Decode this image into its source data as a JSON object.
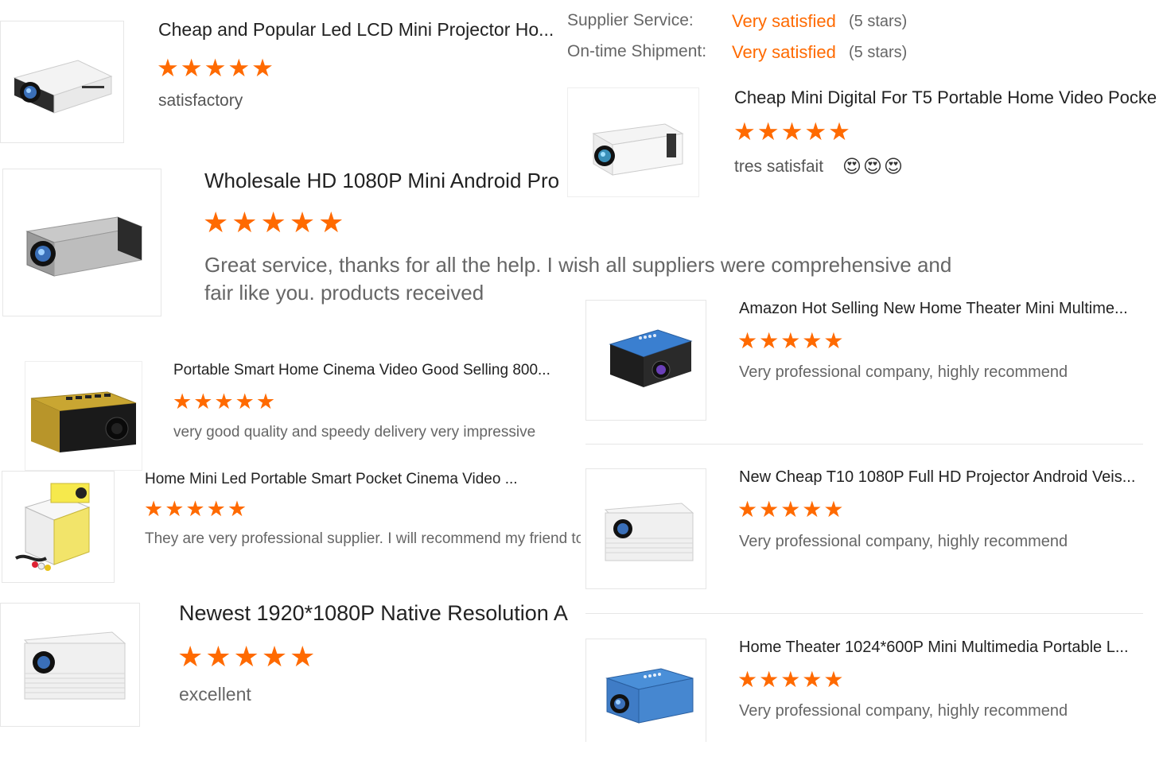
{
  "rating_summary": {
    "supplier_service_label": "Supplier Service:",
    "supplier_service_value": "Very satisfied",
    "supplier_service_stars": "(5 stars)",
    "shipment_label": "On-time Shipment:",
    "shipment_value": "Very satisfied",
    "shipment_stars": "(5 stars)"
  },
  "star_glyphs": "★★★★★",
  "reviews": [
    {
      "title": "Cheap and Popular Led LCD Mini Projector Ho...",
      "comment": "satisfactory",
      "rating": 5,
      "image": "white-projector-icon"
    },
    {
      "title": "Cheap Mini Digital For T5 Portable Home Video Pocke",
      "comment": "tres satisfait",
      "emoji": "😍😍😍",
      "rating": 5,
      "image": "white-projector-icon"
    },
    {
      "title": "Wholesale HD 1080P Mini Android Pro",
      "comment_line1": "Great service, thanks for all the help. I wish all suppliers were comprehensive and",
      "comment_line2": "fair like you. products received",
      "rating": 5,
      "image": "silver-projector-icon"
    },
    {
      "title": "Amazon Hot Selling New Home Theater Mini Multime...",
      "comment": "Very professional company, highly recommend",
      "rating": 5,
      "image": "blue-projector-icon"
    },
    {
      "title": "Portable Smart Home Cinema Video Good Selling 800...",
      "comment": "very good quality and speedy delivery very impressive",
      "rating": 5,
      "image": "yellow-projector-icon"
    },
    {
      "title": "Home Mini Led Portable Smart Pocket Cinema Video ...",
      "comment": "They are very professional supplier. I will recommend my friend to",
      "rating": 5,
      "image": "yellow-mini-projector-icon"
    },
    {
      "title": "New Cheap T10 1080P Full HD Projector Android Veis...",
      "comment": "Very professional company, highly recommend",
      "rating": 5,
      "image": "white-projector-icon"
    },
    {
      "title": "Newest 1920*1080P Native Resolution A",
      "comment": "excellent",
      "rating": 5,
      "image": "white-projector-icon"
    },
    {
      "title": "Home Theater 1024*600P Mini Multimedia Portable L...",
      "comment": "Very professional company, highly recommend",
      "rating": 5,
      "image": "blue-projector-icon"
    }
  ],
  "colors": {
    "accent": "#ff6a00",
    "title": "#222222",
    "comment": "#555555",
    "border": "#e6e6e6"
  }
}
